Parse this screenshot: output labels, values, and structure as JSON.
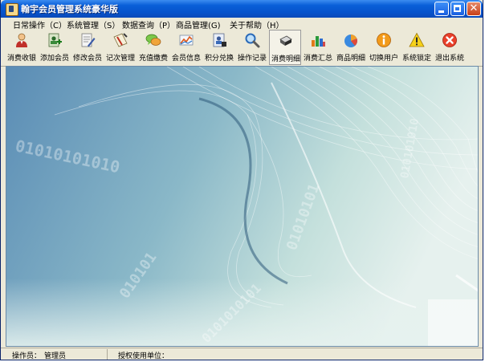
{
  "window": {
    "title": "翰宇会员管理系统豪华版",
    "controls": {
      "minimize": "minimize",
      "maximize": "maximize",
      "close": "close"
    }
  },
  "menu": [
    {
      "label": "日常操作（C）"
    },
    {
      "label": "系统管理（S）"
    },
    {
      "label": "数据查询（P）"
    },
    {
      "label": "商品管理(G)"
    },
    {
      "label": "关于帮助（H）"
    }
  ],
  "toolbar": [
    {
      "label": "消费收银",
      "icon": "cashier-person-icon"
    },
    {
      "label": "添加会员",
      "icon": "add-member-icon"
    },
    {
      "label": "修改会员",
      "icon": "edit-member-icon"
    },
    {
      "label": "记次管理",
      "icon": "count-record-icon"
    },
    {
      "label": "充值缴费",
      "icon": "recharge-chat-icon"
    },
    {
      "label": "会员信息",
      "icon": "member-info-chart-icon"
    },
    {
      "label": "积分兑换",
      "icon": "points-exchange-icon"
    },
    {
      "label": "操作记录",
      "icon": "magnifier-icon"
    },
    {
      "label": "消费明细",
      "icon": "consumption-detail-icon"
    },
    {
      "label": "消费汇总",
      "icon": "bar-chart-icon"
    },
    {
      "label": "商品明细",
      "icon": "pie-chart-icon"
    },
    {
      "label": "切换用户",
      "icon": "info-icon"
    },
    {
      "label": "系统锁定",
      "icon": "warning-icon"
    },
    {
      "label": "退出系统",
      "icon": "exit-icon"
    }
  ],
  "background_digits": [
    "01010101010",
    "010101",
    "01010101",
    "0101010101",
    "010101010"
  ],
  "statusbar": {
    "operator_label": "操作员：",
    "operator_value": "管理员",
    "license_label": "授权使用单位："
  },
  "colors": {
    "titlebar": "#0a5fd8",
    "window_face": "#ece9d8",
    "canvas_left": "#5a8cb5",
    "canvas_right": "#e6f1ee"
  }
}
